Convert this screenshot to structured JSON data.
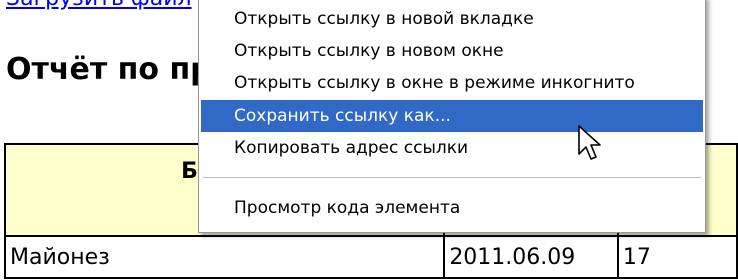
{
  "page": {
    "top_link": "Загрузить файл",
    "heading": "Отчёт по продажам",
    "table": {
      "header": [
        "Блюдо",
        "",
        ""
      ],
      "rows": [
        [
          "Майонез",
          "2011.06.09",
          "17"
        ]
      ]
    }
  },
  "context_menu": {
    "items": [
      {
        "label": "Открыть ссылку в новой вкладке",
        "highlighted": false
      },
      {
        "label": "Открыть ссылку в новом окне",
        "highlighted": false
      },
      {
        "label": "Открыть ссылку в окне в режиме инкогнито",
        "highlighted": false
      },
      {
        "label": "Сохранить ссылку как...",
        "highlighted": true
      },
      {
        "label": "Копировать адрес ссылки",
        "highlighted": false
      },
      {
        "label": "Просмотр кода элемента",
        "highlighted": false
      }
    ],
    "highlight_color": "#3169c6"
  },
  "cursor": {
    "icon": "arrow-pointer-icon"
  }
}
